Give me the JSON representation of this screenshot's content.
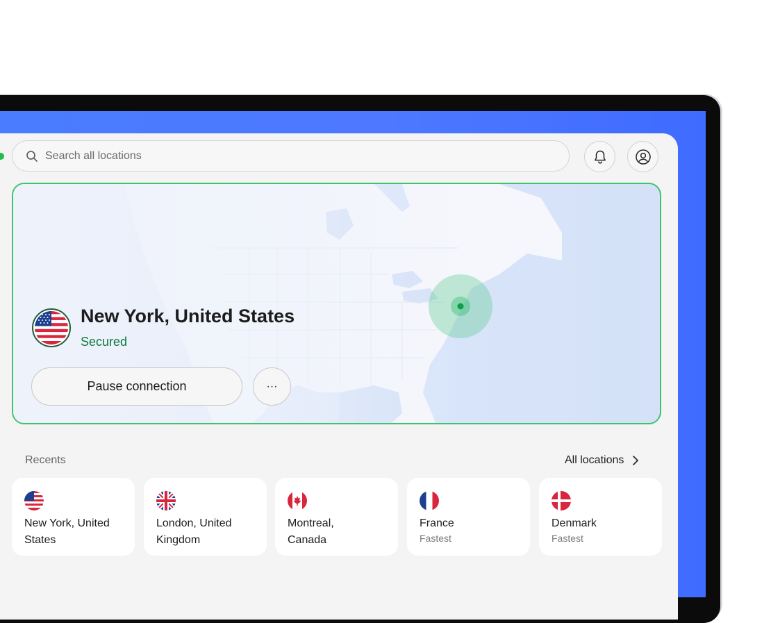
{
  "search": {
    "placeholder": "Search all locations"
  },
  "header": {
    "notifications_icon": "bell-icon",
    "account_icon": "user-circle-icon"
  },
  "connection": {
    "location": "New York, United States",
    "status": "Secured",
    "pause_label": "Pause connection",
    "more_label": "···",
    "status_color": "#0b7a3b",
    "accent_border": "#3ec46d"
  },
  "recents": {
    "label": "Recents",
    "all_locations_label": "All locations",
    "items": [
      {
        "name": "New York, United States",
        "sub": "",
        "flag": "us-flag-icon"
      },
      {
        "name": "London, United Kingdom",
        "sub": "",
        "flag": "uk-flag-icon"
      },
      {
        "name": "Montreal, Canada",
        "sub": "",
        "flag": "canada-flag-icon"
      },
      {
        "name": "France",
        "sub": "Fastest",
        "flag": "france-flag-icon"
      },
      {
        "name": "Denmark",
        "sub": "Fastest",
        "flag": "denmark-flag-icon"
      }
    ]
  },
  "colors": {
    "screen_bg": "#4a7cff",
    "app_bg": "#f4f4f4",
    "connected_dot": "#1fbf4b"
  }
}
